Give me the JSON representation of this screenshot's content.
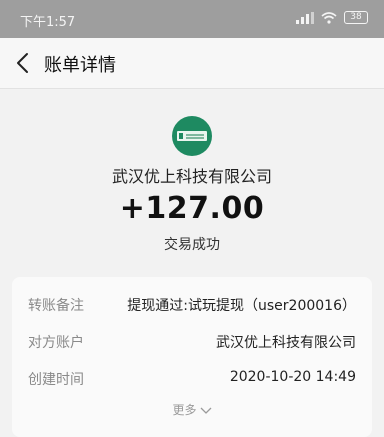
{
  "status_bar": {
    "time": "下午1:57",
    "signal_icon": "signal-icon",
    "wifi_icon": "wifi-icon",
    "battery_level": "38"
  },
  "header": {
    "back_icon": "chevron-left-icon",
    "title": "账单详情"
  },
  "transaction": {
    "logo_icon": "company-logo",
    "company": "武汉优上科技有限公司",
    "amount": "+127.00",
    "status": "交易成功"
  },
  "details": [
    {
      "label": "转账备注",
      "value": "提现通过:试玩提现（user200016）"
    },
    {
      "label": "对方账户",
      "value": "武汉优上科技有限公司"
    },
    {
      "label": "创建时间",
      "value": "2020-10-20 14:49"
    }
  ],
  "more": {
    "label": "更多",
    "icon": "chevron-down-icon"
  },
  "colors": {
    "brand_green": "#1e8a61",
    "status_bar": "#9e9e9e",
    "background": "#f2f2f2"
  }
}
